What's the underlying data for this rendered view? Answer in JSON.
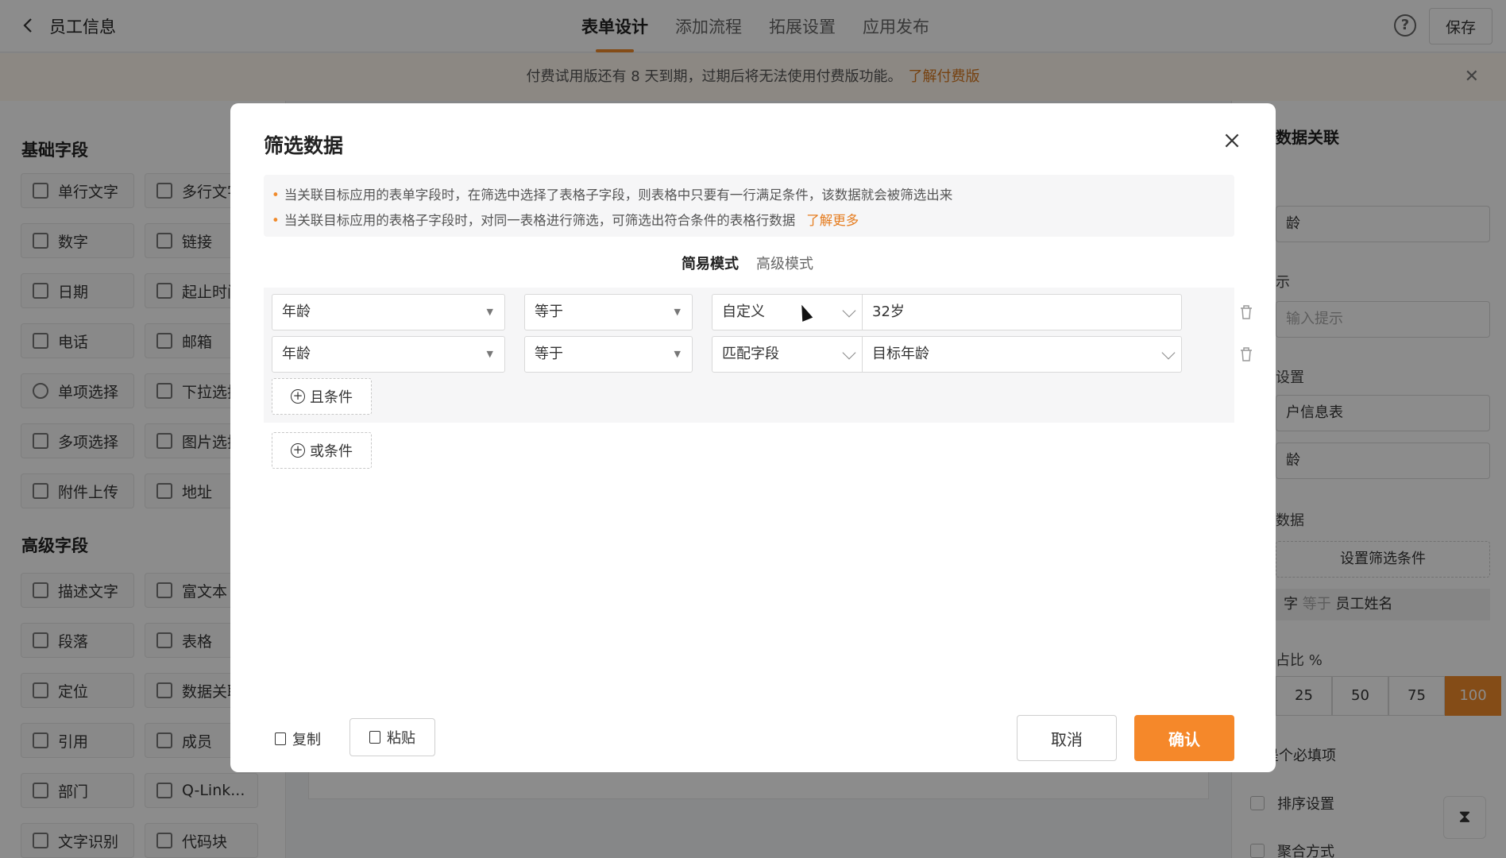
{
  "header": {
    "back_icon": "chevron-left-icon",
    "title": "员工信息",
    "tabs": [
      {
        "label": "表单设计",
        "active": true
      },
      {
        "label": "添加流程",
        "active": false
      },
      {
        "label": "拓展设置",
        "active": false
      },
      {
        "label": "应用发布",
        "active": false
      }
    ],
    "help_label": "?",
    "save_label": "保存"
  },
  "notice": {
    "text": "付费试用版还有 8 天到期，过期后将无法使用付费版功能。",
    "link": "了解付费版",
    "close_label": "✕"
  },
  "left_panel": {
    "basic_title": "基础字段",
    "basic_fields": [
      "单行文字",
      "多行文字",
      "数字",
      "链接",
      "日期",
      "起止时间",
      "电话",
      "邮箱",
      "单项选择",
      "下拉选择",
      "多项选择",
      "图片选择",
      "附件上传",
      "地址"
    ],
    "advanced_title": "高级字段",
    "advanced_fields": [
      "描述文字",
      "富文本",
      "段落",
      "表格",
      "定位",
      "数据关联",
      "引用",
      "成员",
      "部门",
      "Q-Link...",
      "文字识别",
      "代码块"
    ]
  },
  "right_panel": {
    "title": "数据关联",
    "field_value": "龄",
    "placeholder_value": "输入提示",
    "form_select": "户信息表",
    "field_select": "龄",
    "data_label": "数据",
    "set_filter_label": "设置筛选条件",
    "condition": {
      "left": "字",
      "op": "等于",
      "right": "员工姓名"
    },
    "width_label": "占比 %",
    "width_options": [
      "25",
      "50",
      "75",
      "100"
    ],
    "width_selected": "100",
    "required_label": "这是个必填项",
    "sort_label": "排序设置",
    "aggregate_label": "聚合方式",
    "settings_label": "设置",
    "label2": "示"
  },
  "modal": {
    "title": "筛选数据",
    "close_label": "✕",
    "tips": [
      "当关联目标应用的表单字段时，在筛选中选择了表格子字段，则表格中只要有一行满足条件，该数据就会被筛选出来",
      "当关联目标应用的表格子字段时，对同一表格进行筛选，可筛选出符合条件的表格行数据"
    ],
    "learn_more": "了解更多",
    "mode_tabs": [
      {
        "label": "简易模式",
        "active": true
      },
      {
        "label": "高级模式",
        "active": false
      }
    ],
    "conditions": [
      {
        "field": "年龄",
        "operator": "等于",
        "value_type": "自定义",
        "value": "32岁"
      },
      {
        "field": "年龄",
        "operator": "等于",
        "value_type": "匹配字段",
        "value": "目标年龄"
      }
    ],
    "and_condition_label": "且条件",
    "or_condition_label": "或条件",
    "copy_label": "复制",
    "paste_label": "粘贴",
    "cancel_label": "取消",
    "confirm_label": "确认"
  },
  "colors": {
    "accent": "#f08a2b",
    "overlay": "rgba(0,0,0,0.45)"
  }
}
